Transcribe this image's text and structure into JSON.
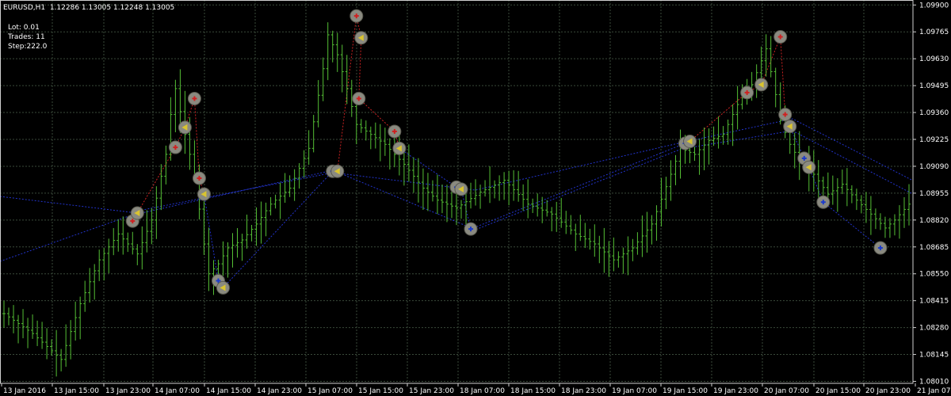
{
  "header": {
    "symbol_line": "EURUSD,H1  1.12286 1.13005 1.12248 1.13005",
    "lot": "Lot: 0.01",
    "trades": "Trades: 11",
    "step": "Step:222.0"
  },
  "colors": {
    "background": "#000000",
    "grid": "#3a4a3a",
    "candle": "#55c035",
    "axis_text": "#ffffff",
    "buy_trend": "#2233cc",
    "sell_trend": "#cc2222",
    "marker_ring": "#8a8a80"
  },
  "chart_data": {
    "type": "bar",
    "title": "EURUSD,H1",
    "ylim": [
      1.08,
      1.09925
    ],
    "y_ticks": [
      "1.09900",
      "1.09765",
      "1.09630",
      "1.09495",
      "1.09360",
      "1.09225",
      "1.09090",
      "1.08955",
      "1.08820",
      "1.08685",
      "1.08550",
      "1.08415",
      "1.08280",
      "1.08145",
      "1.08010"
    ],
    "x_ticks": [
      "13 Jan 2016",
      "13 Jan 15:00",
      "13 Jan 23:00",
      "14 Jan 07:00",
      "14 Jan 15:00",
      "14 Jan 23:00",
      "15 Jan 07:00",
      "15 Jan 15:00",
      "15 Jan 23:00",
      "18 Jan 07:00",
      "18 Jan 15:00",
      "18 Jan 23:00",
      "19 Jan 07:00",
      "19 Jan 15:00",
      "19 Jan 23:00",
      "20 Jan 07:00",
      "20 Jan 15:00",
      "20 Jan 23:00",
      "21 Jan 07:00"
    ],
    "close_path": [
      [
        0,
        1.0835
      ],
      [
        6,
        1.0825
      ],
      [
        12,
        1.0812
      ],
      [
        16,
        1.084
      ],
      [
        20,
        1.0862
      ],
      [
        24,
        1.0875
      ],
      [
        28,
        1.0865
      ],
      [
        31,
        1.0882
      ],
      [
        34,
        1.0915
      ],
      [
        35,
        1.0935
      ],
      [
        36,
        1.0948
      ],
      [
        38,
        1.0925
      ],
      [
        40,
        1.0905
      ],
      [
        42,
        1.087
      ],
      [
        43,
        1.0855
      ],
      [
        45,
        1.086
      ],
      [
        47,
        1.0868
      ],
      [
        50,
        1.0872
      ],
      [
        53,
        1.088
      ],
      [
        56,
        1.089
      ],
      [
        60,
        1.0898
      ],
      [
        64,
        1.0918
      ],
      [
        67,
        1.0958
      ],
      [
        68,
        1.0975
      ],
      [
        70,
        1.0965
      ],
      [
        72,
        1.0948
      ],
      [
        74,
        1.093
      ],
      [
        77,
        1.0925
      ],
      [
        80,
        1.092
      ],
      [
        84,
        1.091
      ],
      [
        88,
        1.0898
      ],
      [
        91,
        1.0892
      ],
      [
        95,
        1.0888
      ],
      [
        100,
        1.0896
      ],
      [
        105,
        1.0902
      ],
      [
        110,
        1.089
      ],
      [
        115,
        1.0885
      ],
      [
        120,
        1.0875
      ],
      [
        124,
        1.087
      ],
      [
        128,
        1.0862
      ],
      [
        132,
        1.0868
      ],
      [
        136,
        1.088
      ],
      [
        140,
        1.0905
      ],
      [
        142,
        1.0918
      ],
      [
        145,
        1.0915
      ],
      [
        148,
        1.0922
      ],
      [
        151,
        1.0925
      ],
      [
        154,
        1.094
      ],
      [
        157,
        1.095
      ],
      [
        160,
        1.0968
      ],
      [
        162,
        1.0945
      ],
      [
        163,
        1.0932
      ],
      [
        165,
        1.092
      ],
      [
        167,
        1.0912
      ],
      [
        170,
        1.0905
      ],
      [
        173,
        1.0895
      ],
      [
        176,
        1.09
      ],
      [
        179,
        1.0892
      ],
      [
        182,
        1.0885
      ],
      [
        185,
        1.0878
      ],
      [
        187,
        1.0882
      ],
      [
        190,
        1.089
      ]
    ],
    "markers": [
      {
        "t": 27,
        "price": 1.08815,
        "kind": "sell"
      },
      {
        "t": 28,
        "price": 1.08855,
        "kind": "close"
      },
      {
        "t": 36,
        "price": 1.09185,
        "kind": "sell"
      },
      {
        "t": 38,
        "price": 1.09285,
        "kind": "close"
      },
      {
        "t": 40,
        "price": 1.0943,
        "kind": "sell"
      },
      {
        "t": 41,
        "price": 1.0903,
        "kind": "sell"
      },
      {
        "t": 42,
        "price": 1.0895,
        "kind": "close"
      },
      {
        "t": 45,
        "price": 1.08515,
        "kind": "buy"
      },
      {
        "t": 46,
        "price": 1.0848,
        "kind": "close"
      },
      {
        "t": 69,
        "price": 1.09065,
        "kind": "buy"
      },
      {
        "t": 70,
        "price": 1.09065,
        "kind": "close"
      },
      {
        "t": 74,
        "price": 1.09845,
        "kind": "sell"
      },
      {
        "t": 75,
        "price": 1.09735,
        "kind": "close"
      },
      {
        "t": 74.5,
        "price": 1.0943,
        "kind": "sell"
      },
      {
        "t": 82,
        "price": 1.09265,
        "kind": "sell"
      },
      {
        "t": 83,
        "price": 1.0918,
        "kind": "close"
      },
      {
        "t": 95,
        "price": 1.08985,
        "kind": "buy"
      },
      {
        "t": 96,
        "price": 1.08975,
        "kind": "close"
      },
      {
        "t": 98,
        "price": 1.08775,
        "kind": "buy"
      },
      {
        "t": 143,
        "price": 1.09205,
        "kind": "buy"
      },
      {
        "t": 144,
        "price": 1.09215,
        "kind": "close"
      },
      {
        "t": 156,
        "price": 1.0946,
        "kind": "sell"
      },
      {
        "t": 159,
        "price": 1.095,
        "kind": "close"
      },
      {
        "t": 163,
        "price": 1.0974,
        "kind": "sell"
      },
      {
        "t": 164,
        "price": 1.0935,
        "kind": "sell"
      },
      {
        "t": 165,
        "price": 1.0929,
        "kind": "close"
      },
      {
        "t": 168,
        "price": 1.0913,
        "kind": "buy"
      },
      {
        "t": 169,
        "price": 1.09085,
        "kind": "close"
      },
      {
        "t": 172,
        "price": 1.0891,
        "kind": "buy"
      },
      {
        "t": 184,
        "price": 1.0868,
        "kind": "buy"
      }
    ]
  }
}
